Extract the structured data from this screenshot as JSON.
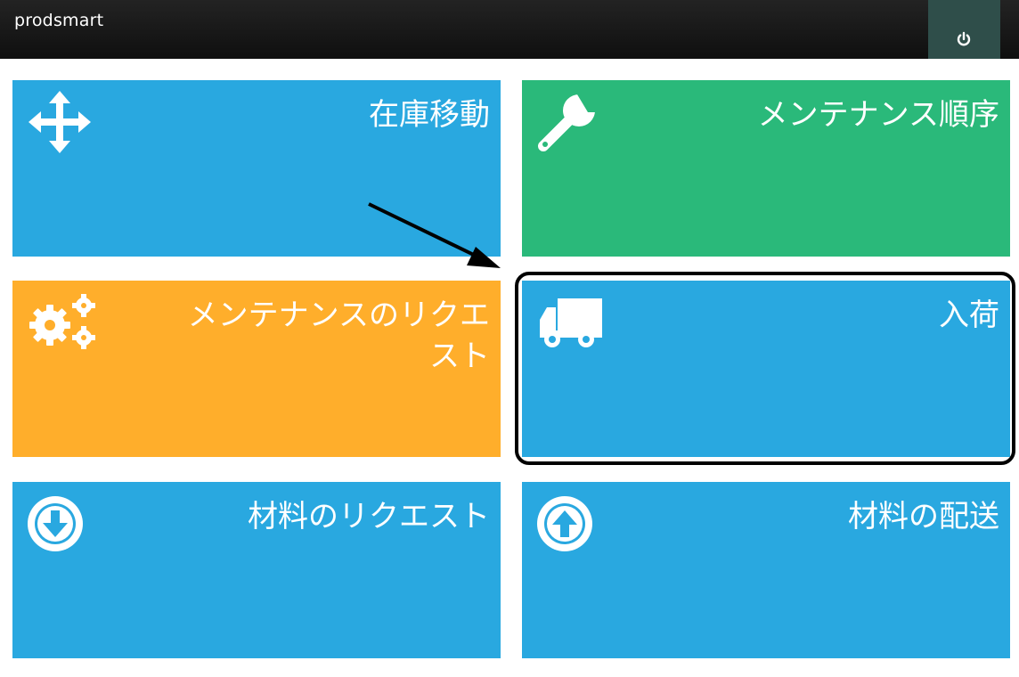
{
  "app": {
    "title": "prodsmart"
  },
  "header": {
    "power_icon": "power-icon"
  },
  "tiles": [
    {
      "label": "在庫移動",
      "icon": "move-arrows-icon",
      "color": "#29a8e0"
    },
    {
      "label": "メンテナンス順序",
      "icon": "wrench-icon",
      "color": "#2ab97a"
    },
    {
      "label": "メンテナンスのリクエスト",
      "icon": "gears-icon",
      "color": "#ffae2b"
    },
    {
      "label": "入荷",
      "icon": "truck-icon",
      "color": "#29a8e0"
    },
    {
      "label": "材料のリクエスト",
      "icon": "arrow-down-circle-icon",
      "color": "#29a8e0"
    },
    {
      "label": "材料の配送",
      "icon": "arrow-up-circle-icon",
      "color": "#29a8e0"
    }
  ],
  "annotation": {
    "highlighted_tile": "入荷",
    "pointer": "arrow-icon"
  }
}
